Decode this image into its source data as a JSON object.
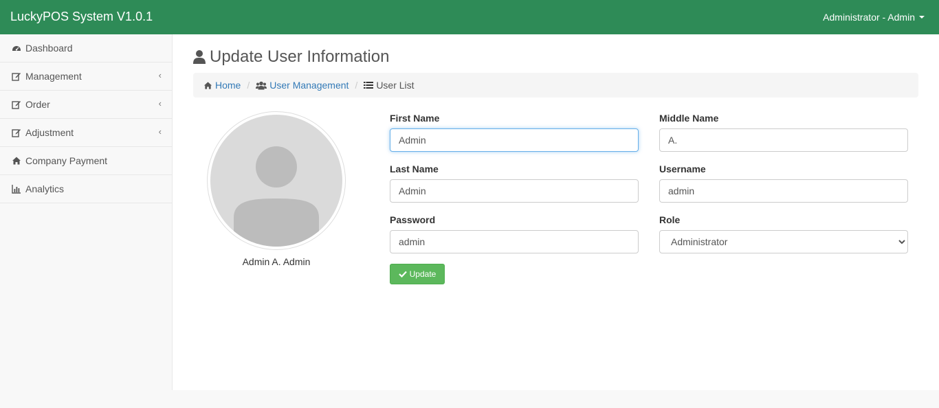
{
  "app": {
    "title": "LuckyPOS System V1.0.1"
  },
  "user_menu": {
    "label": "Administrator - Admin"
  },
  "sidebar": {
    "items": [
      {
        "label": "Dashboard",
        "icon": "dashboard-icon"
      },
      {
        "label": "Management",
        "icon": "edit-icon",
        "has_submenu": true
      },
      {
        "label": "Order",
        "icon": "edit-icon",
        "has_submenu": true
      },
      {
        "label": "Adjustment",
        "icon": "edit-icon",
        "has_submenu": true
      },
      {
        "label": "Company Payment",
        "icon": "home-icon"
      },
      {
        "label": "Analytics",
        "icon": "bar-chart-icon"
      }
    ]
  },
  "page": {
    "title": "Update User Information",
    "title_icon": "user-icon"
  },
  "breadcrumb": {
    "home": "Home",
    "user_management": "User Management",
    "current": "User List"
  },
  "profile": {
    "display_name": "Admin A. Admin",
    "avatar_icon": "default-avatar-icon"
  },
  "form": {
    "first_name": {
      "label": "First Name",
      "value": "Admin"
    },
    "middle_name": {
      "label": "Middle Name",
      "value": "A."
    },
    "last_name": {
      "label": "Last Name",
      "value": "Admin"
    },
    "username": {
      "label": "Username",
      "value": "admin"
    },
    "password": {
      "label": "Password",
      "value": "admin"
    },
    "role": {
      "label": "Role",
      "value": "Administrator"
    },
    "submit_label": "Update"
  },
  "colors": {
    "topbar": "#2e8b57",
    "link": "#337ab7",
    "success_button": "#5cb85c",
    "focus_border": "#66afe9"
  }
}
